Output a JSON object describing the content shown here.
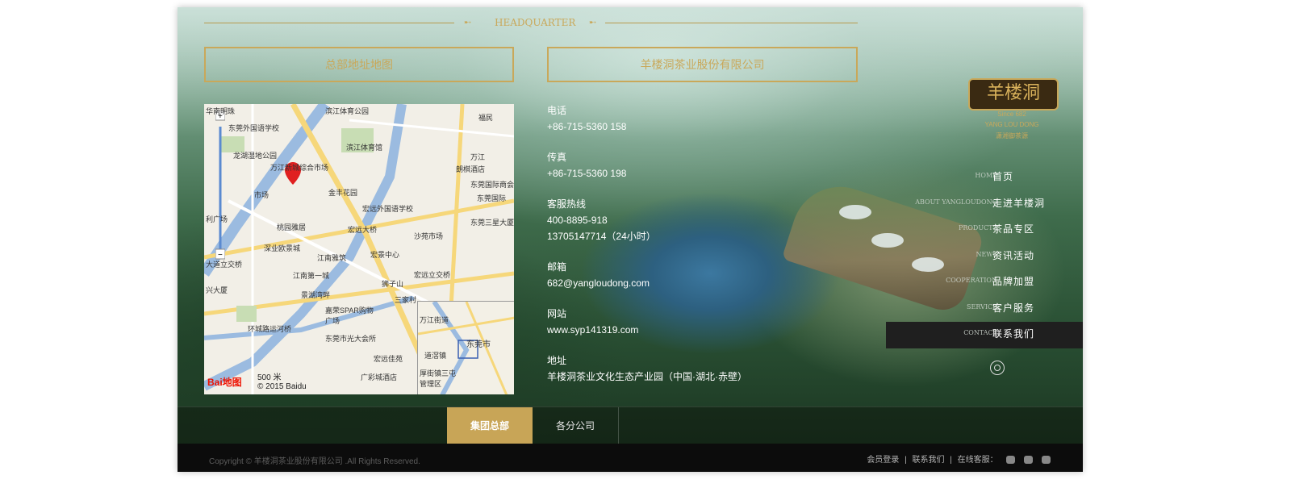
{
  "header": {
    "title": "HEADQUARTER"
  },
  "sections": {
    "map_title": "总部地址地图",
    "company_title": "羊楼洞茶业股份有限公司"
  },
  "map": {
    "labels": [
      "滨江体育公园",
      "滨江体育馆",
      "华南明珠",
      "东莞外国语学校",
      "龙湖湿地公园",
      "万江新城综合市场",
      "市场",
      "金丰花园",
      "朗棋酒店",
      "东莞国际商会大厦",
      "宏远外国语学校",
      "桃园雅居",
      "宏远大桥",
      "东莞三星大厦",
      "沙苑市场",
      "深业欧景城",
      "江南雅筑",
      "宏景中心",
      "宏远立交桥",
      "狮子山",
      "大道立交桥",
      "江南第一城",
      "景湖湾畔",
      "嘉荣SPAR购物广场",
      "三家村",
      "环城路运河桥",
      "东莞市光大会所",
      "宏远佳苑",
      "广彩城酒店",
      "东莞市",
      "万江",
      "兴大厦",
      "利广场",
      "东莞国际",
      "福民"
    ],
    "scale": "500 米",
    "copyright": "© 2015 Baidu",
    "logo": "Bai地图",
    "mini_label": "东莞市",
    "mini_labels": [
      "万江街道",
      "道滘镇",
      "厚街镇三屯管理区"
    ]
  },
  "contacts": [
    {
      "label": "电话",
      "values": [
        "+86-715-5360 158"
      ]
    },
    {
      "label": "传真",
      "values": [
        "+86-715-5360 198"
      ]
    },
    {
      "label": "客服热线",
      "values": [
        "400-8895-918",
        "13705147714（24小时）"
      ]
    },
    {
      "label": "邮箱",
      "values": [
        "682@yangloudong.com"
      ]
    },
    {
      "label": "网站",
      "values": [
        "www.syp141319.com"
      ]
    },
    {
      "label": "地址",
      "values": [
        "羊楼洞茶业文化生态产业园（中国·湖北·赤壁）"
      ]
    }
  ],
  "brand": {
    "name": "羊楼洞",
    "since": "Since 682",
    "en": "YANG LOU DONG",
    "slogan": "潇湘御茶源"
  },
  "nav": [
    {
      "en": "HOME",
      "zh": "首页"
    },
    {
      "en": "ABOUT YANGLOUDONG",
      "zh": "走进羊楼洞"
    },
    {
      "en": "PRODUCTS",
      "zh": "茶品专区"
    },
    {
      "en": "NEWS",
      "zh": "资讯活动"
    },
    {
      "en": "COOPERATION",
      "zh": "品牌加盟"
    },
    {
      "en": "SERVICE",
      "zh": "客户服务"
    },
    {
      "en": "CONTACT",
      "zh": "联系我们"
    }
  ],
  "tabs": [
    "集团总部",
    "各分公司"
  ],
  "footer": {
    "copyright": "Copyright © 羊楼洞茶业股份有限公司 .All Rights Reserved.",
    "links": [
      "会员登录",
      "联系我们",
      "在线客服："
    ]
  },
  "icons": [
    "search-icon",
    "qq-icon",
    "wechat-icon",
    "mail-icon",
    "map-marker-icon"
  ]
}
